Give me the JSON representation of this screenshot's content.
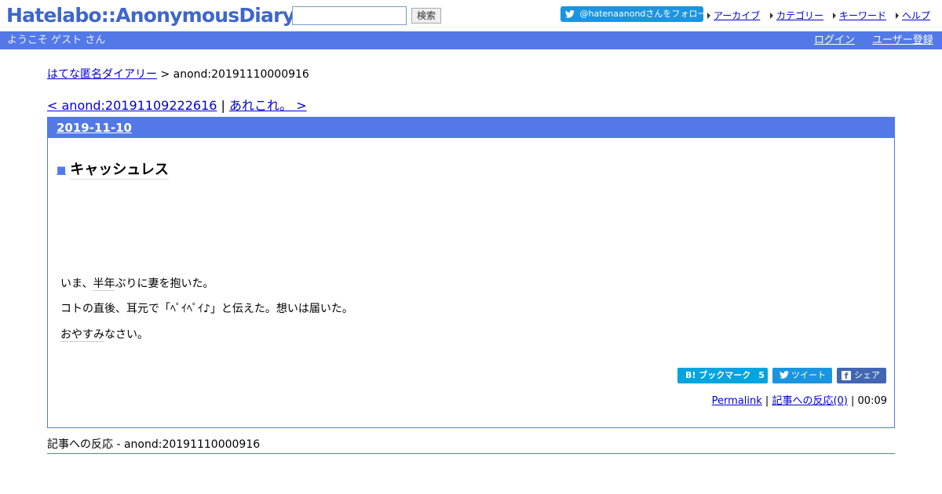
{
  "header": {
    "logo": "Hatelabo::AnonymousDiary",
    "search_placeholder": "",
    "search_button": "検索",
    "twitter_follow": "@hatenaanondさんをフォロー",
    "links": [
      "アーカイブ",
      "カテゴリー",
      "キーワード",
      "ヘルプ"
    ]
  },
  "userbar": {
    "welcome": "ようこそ ゲスト さん",
    "login": "ログイン",
    "register": "ユーザー登録"
  },
  "breadcrumb": {
    "home": "はてな匿名ダイアリー",
    "separator": " > ",
    "current": "anond:20191110000916"
  },
  "prevnext": {
    "prev": "< anond:20191109222616",
    "separator": " | ",
    "next": "あれこれ。 >"
  },
  "day": {
    "date": "2019-11-10",
    "section_marker": "■",
    "title": "キャッシュレス",
    "paragraphs": [
      [
        "いま、",
        "半年",
        "ぶりに妻を抱いた。"
      ],
      [
        "コトの直後、耳元で「ﾍﾟｲﾍﾟｲ♪」と伝えた。想いは届いた。"
      ],
      [
        "",
        "おやすみ",
        "なさい。"
      ]
    ],
    "share": {
      "hatebu_label": "B! ブックマーク",
      "hatebu_count": "5",
      "tweet_label": "ツイート",
      "fb_label": "シェア"
    },
    "footer": {
      "permalink": "Permalink",
      "separator": " | ",
      "reactions": "記事への反応(0)",
      "time": "00:09"
    }
  },
  "reactions_heading": "記事への反応 - anond:20191110000916",
  "colors": {
    "accent": "#5279e7",
    "logo": "#3f67c9",
    "hatebu": "#00a4de",
    "twitter": "#1b95e0",
    "facebook": "#4267b2"
  }
}
